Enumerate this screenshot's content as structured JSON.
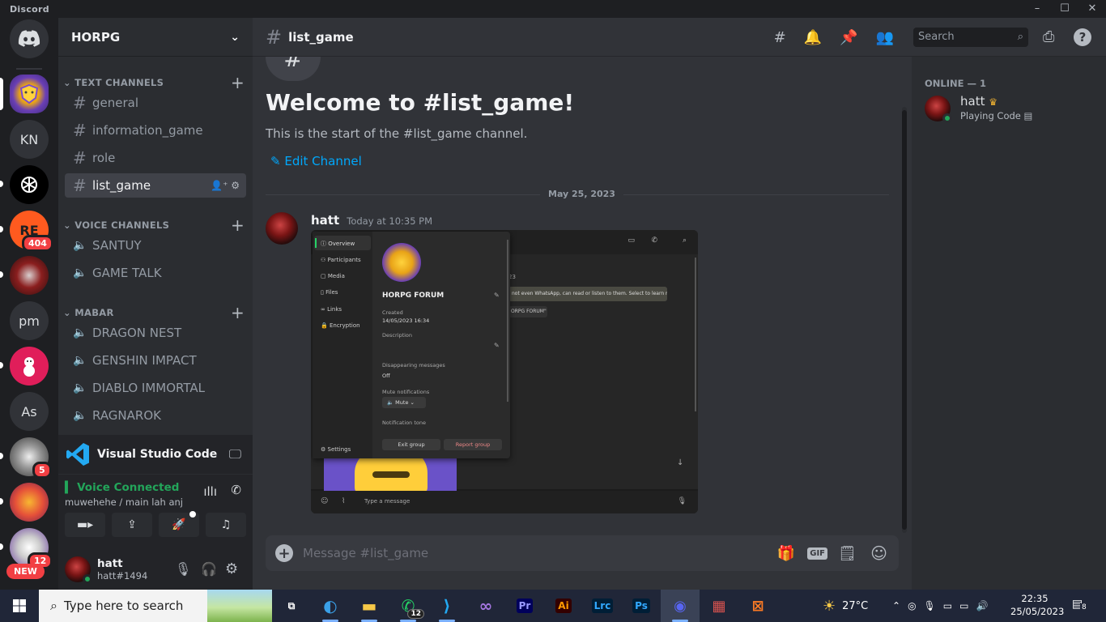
{
  "window": {
    "title": "Discord"
  },
  "rail": {
    "servers": [
      {
        "label": "KN"
      },
      {
        "label": "pm"
      },
      {
        "label": "As"
      }
    ],
    "badges": {
      "r404": "404",
      "avatar5": "5",
      "bottom12": "12"
    },
    "new_label": "NEW"
  },
  "guild": {
    "name": "HORPG"
  },
  "categories": {
    "text": "TEXT CHANNELS",
    "voice": "VOICE CHANNELS",
    "mabar": "MABAR"
  },
  "text_channels": [
    "general",
    "information_game",
    "role",
    "list_game"
  ],
  "voice_channels": [
    "SANTUY",
    "GAME TALK"
  ],
  "mabar_channels": [
    "DRAGON NEST",
    "GENSHIN IMPACT",
    "DIABLO IMMORTAL",
    "RAGNAROK"
  ],
  "activity": {
    "name": "Visual Studio Code"
  },
  "voice": {
    "status": "Voice Connected",
    "location": "muwehehe / main lah anj"
  },
  "user": {
    "name": "hatt",
    "tag": "hatt#1494"
  },
  "channel": {
    "name": "list_game",
    "welcome": "Welcome to #list_game!",
    "start_text": "This is the start of the #list_game channel.",
    "edit_label": "Edit Channel",
    "date_divider": "May 25, 2023"
  },
  "message": {
    "author": "hatt",
    "timestamp": "Today at 10:35 PM",
    "attachment": {
      "menu": [
        "Overview",
        "Participants",
        "Media",
        "Files",
        "Links",
        "Encryption"
      ],
      "settings": "Settings",
      "group_name": "HORPG FORUM",
      "created_label": "Created",
      "created_value": "14/05/2023 16:34",
      "description_label": "Description",
      "disappearing_label": "Disappearing messages",
      "disappearing_value": "Off",
      "mute_label": "Mute notifications",
      "mute_button": "Mute",
      "tone_label": "Notification tone",
      "exit_button": "Exit group",
      "report_button": "Report group",
      "chat_date": "23",
      "bubble_text": "not even WhatsApp, can read or listen to them. Select to learn more.",
      "bubble2_text": "ORPG FORUM\"",
      "type_placeholder": "Type a message"
    }
  },
  "composer": {
    "placeholder": "Message #list_game"
  },
  "search": {
    "placeholder": "Search"
  },
  "members": {
    "header": "ONLINE — 1",
    "list": [
      {
        "name": "hatt",
        "activity": "Playing Code"
      }
    ]
  },
  "taskbar": {
    "search_placeholder": "Type here to search",
    "whatsapp_badge": "12",
    "weather": "27°C",
    "time": "22:35",
    "date": "25/05/2023",
    "notif_count": "8",
    "apps": [
      "Pr",
      "Ai",
      "Lrc",
      "Ps"
    ]
  }
}
